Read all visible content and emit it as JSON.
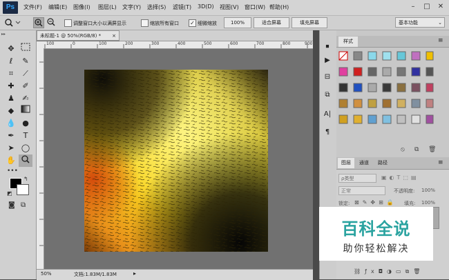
{
  "app": {
    "logo": "Ps"
  },
  "menubar": {
    "items": [
      "文件(F)",
      "编辑(E)",
      "图像(I)",
      "图层(L)",
      "文字(Y)",
      "选择(S)",
      "滤镜(T)",
      "3D(D)",
      "视图(V)",
      "窗口(W)",
      "帮助(H)"
    ],
    "window_controls": [
      "–",
      "□",
      "✕"
    ]
  },
  "options": {
    "zoom_in": "+",
    "zoom_out": "−",
    "resize_windows_label": "调整窗口大小以满屏显示",
    "zoom_all_label": "缩放所有窗口",
    "scrubby_zoom_label": "细微缩放",
    "zoom_100": "100%",
    "fit_screen": "适合屏幕",
    "fill_screen": "填充屏幕",
    "workspace": "基本功能"
  },
  "document": {
    "tab_title": "未标题-1 @ 50%(RGB/8) *",
    "ruler_ticks": [
      "100",
      "0",
      "100",
      "200",
      "300",
      "400",
      "500",
      "600",
      "700",
      "800",
      "900"
    ],
    "zoom_value": "50%",
    "doc_info": "文档:1.83M/1.83M"
  },
  "styles_panel": {
    "title": "样式"
  },
  "layers_panel": {
    "tabs": [
      "图层",
      "通道",
      "路径"
    ],
    "filter_label": "ρ类型",
    "blend_mode": "正常",
    "opacity_label": "不透明度:",
    "opacity_value": "100%",
    "lock_label": "锁定:",
    "fill_label": "填充:",
    "fill_value": "100%"
  },
  "watermark": {
    "main": "百科全说",
    "sub": "助你轻松解决"
  },
  "colors": {
    "accent": "#2aa3a0",
    "ps_blue": "#33a7ff"
  }
}
